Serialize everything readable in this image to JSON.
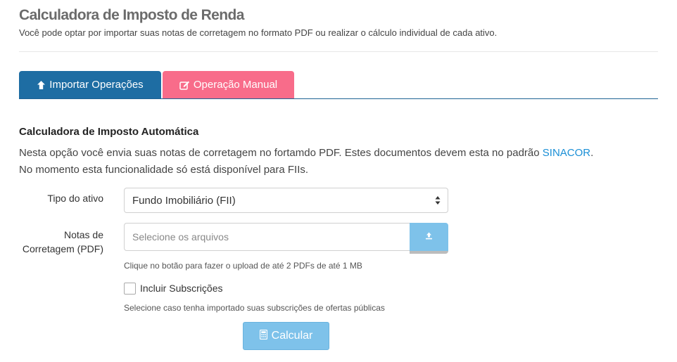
{
  "header": {
    "title": "Calculadora de Imposto de Renda",
    "subtitle": "Você pode optar por importar suas notas de corretagem no formato PDF ou realizar o cálculo individual de cada ativo."
  },
  "tabs": [
    {
      "label": "Importar Operações",
      "icon": "arrow-up-icon",
      "color": "#1e6da3",
      "active": true
    },
    {
      "label": "Operação Manual",
      "icon": "edit-icon",
      "color": "#f86c8a",
      "active": false
    }
  ],
  "section": {
    "heading": "Calculadora de Imposto Automática",
    "description_before_link": "Nesta opção você envia suas notas de corretagem no fortamdo PDF. Estes documentos devem esta no padrão ",
    "link_text": "SINACOR",
    "description_after_link": ".",
    "description_line2": "No momento esta funcionalidade só está disponível para FIIs."
  },
  "form": {
    "asset_type_label": "Tipo do ativo",
    "asset_type_value": "Fundo Imobiliário (FII)",
    "notes_label_line1": "Notas de",
    "notes_label_line2": "Corretagem (PDF)",
    "file_placeholder": "Selecione os arquivos",
    "upload_help": "Clique no botão para fazer o upload de até 2 PDFs de até 1 MB",
    "subscriptions_label": "Incluir Subscrições",
    "subscriptions_checked": false,
    "subscriptions_help": "Selecione caso tenha importado suas subscrições de ofertas públicas",
    "calculate_label": "Calcular",
    "calculate_icon": "calculator-icon"
  },
  "colors": {
    "primary": "#1e6da3",
    "pink": "#f86c8a",
    "light_blue": "#7ec2ea",
    "link": "#1a8fd6"
  }
}
